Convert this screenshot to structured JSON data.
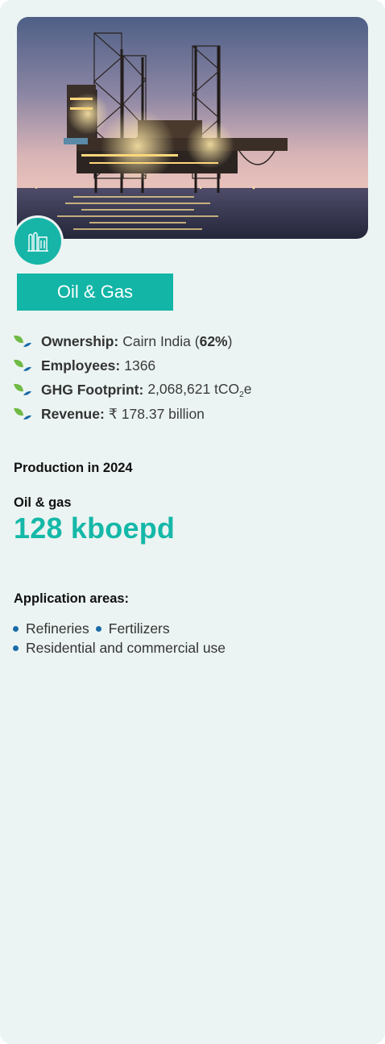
{
  "hero": {
    "image_name": "offshore-oil-rig-photo"
  },
  "badge": {
    "icon": "industry-icon"
  },
  "title": "Oil & Gas",
  "facts": [
    {
      "label": "Ownership:",
      "value_pre": "Cairn India (",
      "value_bold": "62%",
      "value_post": ")"
    },
    {
      "label": "Employees:",
      "value": "1366"
    },
    {
      "label": "GHG Footprint:",
      "value_pre": "2,068,621 tCO",
      "value_sub": "2",
      "value_post": "e"
    },
    {
      "label": "Revenue:",
      "value": "₹ 178.37 billion"
    }
  ],
  "production": {
    "heading": "Production in 2024",
    "metric_label": "Oil & gas",
    "metric_value": "128 kboepd"
  },
  "applications": {
    "heading": "Application areas:",
    "items": [
      "Refineries",
      "Fertilizers",
      "Residential and commercial use"
    ]
  },
  "colors": {
    "accent": "#12b5a6",
    "bullet": "#1a6aa8",
    "background": "#ebf4f2"
  }
}
